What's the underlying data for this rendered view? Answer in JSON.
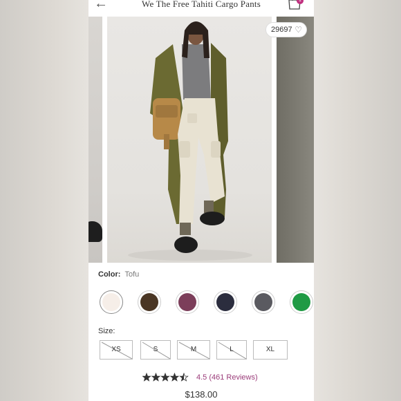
{
  "header": {
    "back_icon": "arrow-left-icon",
    "title": "We The Free Tahiti Cargo Pants",
    "bag_icon": "shopping-bag-icon",
    "bag_count": "1"
  },
  "gallery": {
    "likes_count": "29697",
    "likes_icon": "heart-outline-icon"
  },
  "color": {
    "label": "Color:",
    "selected": "Tofu",
    "swatches": [
      {
        "name": "tofu",
        "hex": "#f6eee8",
        "selected": true
      },
      {
        "name": "brown",
        "hex": "#4a3624"
      },
      {
        "name": "plum",
        "hex": "#7c3e5a"
      },
      {
        "name": "navy",
        "hex": "#2b2d3e"
      },
      {
        "name": "washed-black",
        "hex": "#5a5a60"
      },
      {
        "name": "green",
        "hex": "#1f9a44"
      }
    ]
  },
  "size": {
    "label": "Size:",
    "options": [
      {
        "label": "XS",
        "unavailable": true
      },
      {
        "label": "S",
        "unavailable": true
      },
      {
        "label": "M",
        "unavailable": true
      },
      {
        "label": "L",
        "unavailable": true
      },
      {
        "label": "XL",
        "unavailable": false
      }
    ]
  },
  "reviews": {
    "rating": 4.5,
    "text": "4.5 (461 Reviews)"
  },
  "price": "$138.00",
  "colors": {
    "accent": "#9b3c7a",
    "badge": "#c0307f"
  }
}
